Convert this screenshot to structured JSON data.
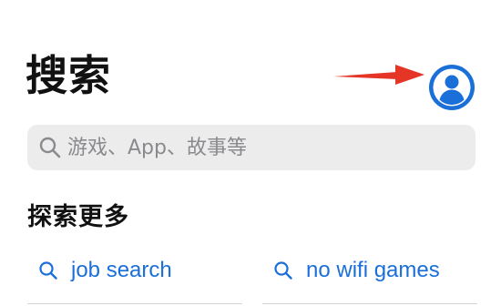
{
  "header": {
    "title": "搜索",
    "avatar_icon": "person-circle-icon",
    "annotation_icon": "red-arrow-icon"
  },
  "search": {
    "placeholder": "游戏、App、故事等",
    "value": "",
    "icon": "search-icon"
  },
  "discover": {
    "title": "探索更多",
    "items": [
      {
        "label": "job search",
        "icon": "search-icon"
      },
      {
        "label": "no wifi games",
        "icon": "search-icon"
      }
    ]
  },
  "colors": {
    "accent": "#1a6fd8",
    "annotation": "#e53527",
    "search_bg": "#ececed",
    "placeholder": "#8a8a8e"
  }
}
